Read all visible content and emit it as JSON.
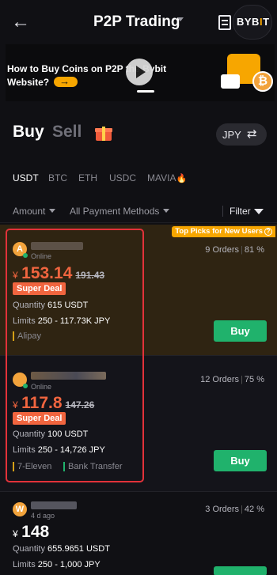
{
  "header": {
    "title": "P2P Trading",
    "brand_prefix": "BYB",
    "brand_accent": "I",
    "brand_suffix": "T"
  },
  "banner": {
    "text": "How to Buy Coins on P2P the Bybit Website?"
  },
  "trade_tabs": {
    "buy": "Buy",
    "sell": "Sell"
  },
  "currency": "JPY",
  "coins": [
    "USDT",
    "BTC",
    "ETH",
    "USDC",
    "MAVIA"
  ],
  "filters": {
    "amount": "Amount",
    "payment": "All Payment Methods",
    "filter": "Filter"
  },
  "ads": [
    {
      "badge": "Top Picks for New Users",
      "avatar_letter": "A",
      "status": "Online",
      "orders": "9 Orders",
      "completion": "81 %",
      "currency_symbol": "¥",
      "price": "153.14",
      "old_price": "191.43",
      "deal": "Super Deal",
      "quantity_label": "Quantity",
      "quantity": "615 USDT",
      "limits_label": "Limits",
      "limits": "250 - 117.73K JPY",
      "payments": [
        "Alipay"
      ],
      "button": "Buy"
    },
    {
      "avatar_letter": "",
      "status": "Online",
      "orders": "12 Orders",
      "completion": "75 %",
      "currency_symbol": "¥",
      "price": "117.8",
      "old_price": "147.26",
      "deal": "Super Deal",
      "quantity_label": "Quantity",
      "quantity": "100 USDT",
      "limits_label": "Limits",
      "limits": "250 - 14,726 JPY",
      "payments": [
        "7-Eleven",
        "Bank Transfer"
      ],
      "button": "Buy"
    },
    {
      "avatar_letter": "W",
      "status": "4 d ago",
      "orders": "3 Orders",
      "completion": "42 %",
      "currency_symbol": "¥",
      "price": "148",
      "quantity_label": "Quantity",
      "quantity": "655.9651 USDT",
      "limits_label": "Limits",
      "limits": "250 - 1,000 JPY"
    }
  ],
  "colors": {
    "accent": "#f7a600",
    "buy_green": "#20b26c",
    "deal_red": "#f1653f",
    "highlight_red": "#e2323a"
  }
}
